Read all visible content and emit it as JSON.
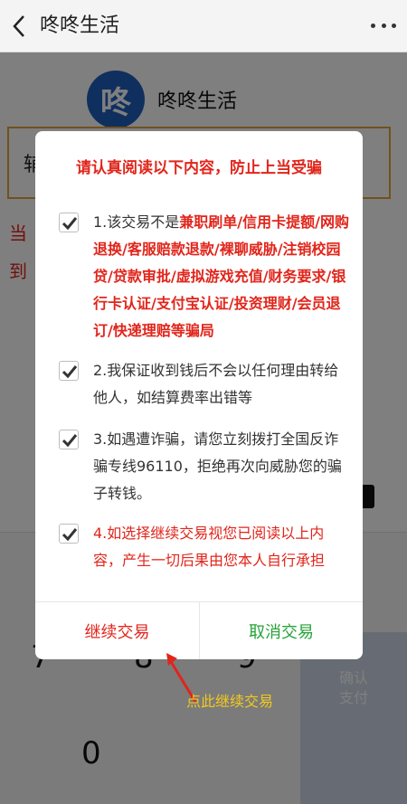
{
  "topbar": {
    "title": "咚咚生活"
  },
  "brand": {
    "logo_char": "咚",
    "name": "咚咚生活"
  },
  "amount_label_partial": "辅",
  "warn_partial_1": "当",
  "warn_partial_2": "到",
  "keypad": {
    "keys": [
      "7",
      "8",
      "9",
      "0"
    ],
    "confirm_label_1": "确认",
    "confirm_label_2": "支付"
  },
  "dialog": {
    "title": "请认真阅读以下内容，防止上当受骗",
    "items": [
      {
        "prefix": "1.该交易不是",
        "highlight": "兼职刷单/信用卡提额/网购退换/客服赔款退款/裸聊威胁/注销校园贷/贷款审批/虚拟游戏充值/财务要求/银行卡认证/支付宝认证/投资理财/会员退订/快递理赔等骗局"
      },
      {
        "text": "2.我保证收到钱后不会以任何理由转给他人，如结算费率出错等"
      },
      {
        "text": "3.如遇遭诈骗，请您立刻拨打全国反诈骗专线96110，拒绝再次向威胁您的骗子转钱。"
      },
      {
        "red": "4.如选择继续交易视您已阅读以上",
        "rest": "内容，产生一切后果由您本人自行承担"
      }
    ],
    "continue_label": "继续交易",
    "cancel_label": "取消交易"
  },
  "annotation": "点此继续交易",
  "colors": {
    "danger": "#e1251b",
    "success": "#26a338",
    "brand": "#1f5fbf",
    "annotation": "#f2c91f"
  }
}
